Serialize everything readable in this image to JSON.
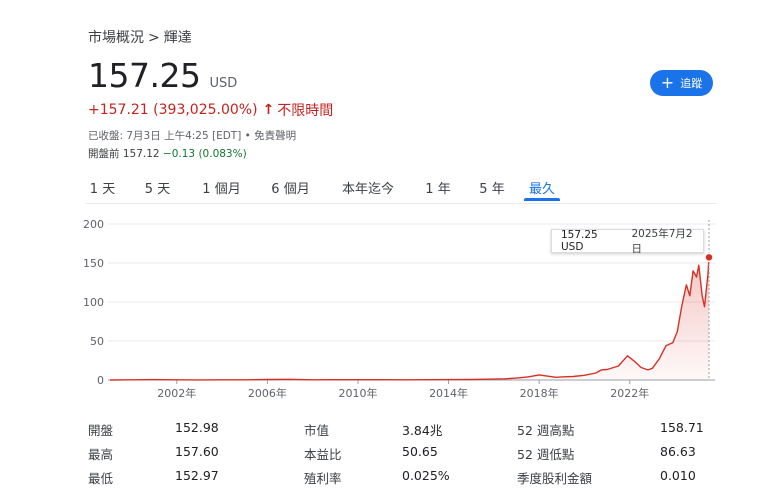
{
  "breadcrumb": {
    "parent": "市場概況",
    "separator": ">",
    "current": "輝達"
  },
  "quote": {
    "price": "157.25",
    "currency": "USD",
    "change": "+157.21 (393,025.00%)",
    "change_arrow": "🡑",
    "period": "不限時間",
    "close_info": "已收盤: 7月3日 上午4:25 [EDT] • 免責聲明",
    "premarket_label": "開盤前",
    "premarket_price": "157.12",
    "premarket_change": "−0.13 (0.083%)"
  },
  "follow_button": {
    "icon": "plus-icon",
    "label": "追蹤"
  },
  "tabs": [
    {
      "label": "1 天",
      "active": false
    },
    {
      "label": "5 天",
      "active": false
    },
    {
      "label": "1 個月",
      "active": false
    },
    {
      "label": "6 個月",
      "active": false
    },
    {
      "label": "本年迄今",
      "active": false
    },
    {
      "label": "1 年",
      "active": false
    },
    {
      "label": "5 年",
      "active": false
    },
    {
      "label": "最久",
      "active": true
    }
  ],
  "tooltip": {
    "price": "157.25 USD",
    "date": "2025年7月2日"
  },
  "colors": {
    "line": "#d93025",
    "accent": "#1a73e8",
    "negative": "#137333",
    "change_red": "#c5221f"
  },
  "chart_data": {
    "type": "area",
    "x": [
      1999.05,
      2000,
      2001,
      2002,
      2003,
      2004,
      2005,
      2006,
      2007,
      2008,
      2009,
      2010,
      2011,
      2012,
      2013,
      2014,
      2015,
      2016,
      2016.5,
      2017,
      2017.5,
      2018,
      2018.75,
      2019,
      2019.5,
      2020,
      2020.5,
      2020.75,
      2021,
      2021.5,
      2021.9,
      2022.25,
      2022.5,
      2022.8,
      2023,
      2023.3,
      2023.6,
      2023.9,
      2024.1,
      2024.3,
      2024.5,
      2024.65,
      2024.8,
      2024.95,
      2025.05,
      2025.2,
      2025.3,
      2025.45,
      2025.5
    ],
    "y": [
      0.04,
      0.3,
      0.5,
      0.3,
      0.1,
      0.2,
      0.3,
      0.6,
      0.9,
      0.3,
      0.4,
      0.4,
      0.4,
      0.3,
      0.4,
      0.5,
      0.6,
      1.2,
      1.5,
      2.5,
      4.0,
      6.5,
      3.5,
      4.0,
      4.5,
      6.0,
      9.0,
      13.0,
      13.5,
      18.0,
      31.0,
      23.0,
      16.0,
      13.0,
      15.0,
      27.0,
      44.0,
      48.0,
      62.0,
      95.0,
      122.0,
      108.0,
      140.0,
      132.0,
      147.0,
      108.0,
      94.0,
      135.0,
      157.25
    ],
    "xlim": [
      1999.05,
      2025.5
    ],
    "ylim": [
      0,
      200
    ],
    "x_ticks": [
      2002,
      2006,
      2010,
      2014,
      2018,
      2022
    ],
    "x_tick_labels": [
      "2002年",
      "2006年",
      "2010年",
      "2014年",
      "2018年",
      "2022年"
    ],
    "y_ticks": [
      0,
      50,
      100,
      150,
      200
    ],
    "y_tick_labels": [
      "0",
      "50",
      "100",
      "150",
      "200"
    ],
    "grid": true,
    "highlight_point": {
      "x": 2025.5,
      "y": 157.25
    }
  },
  "stats": {
    "rows": [
      [
        {
          "label": "開盤",
          "value": "152.98"
        },
        {
          "label": "市值",
          "value": "3.84兆"
        },
        {
          "label": "52 週高點",
          "value": "158.71"
        }
      ],
      [
        {
          "label": "最高",
          "value": "157.60"
        },
        {
          "label": "本益比",
          "value": "50.65"
        },
        {
          "label": "52 週低點",
          "value": "86.63"
        }
      ],
      [
        {
          "label": "最低",
          "value": "152.97"
        },
        {
          "label": "殖利率",
          "value": "0.025%"
        },
        {
          "label": "季度股利金額",
          "value": "0.010"
        }
      ]
    ]
  }
}
